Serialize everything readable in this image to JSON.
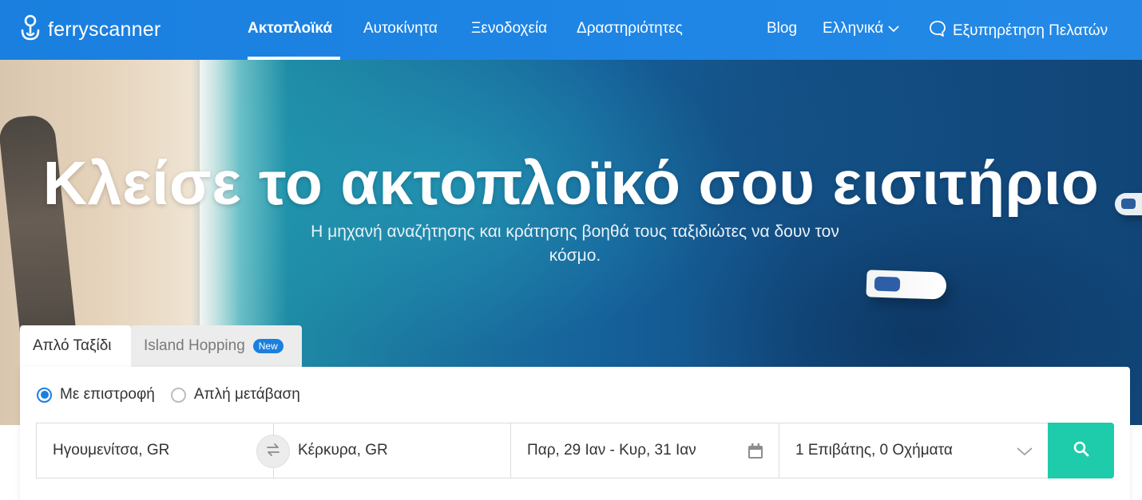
{
  "header": {
    "logo_text": "ferryscanner",
    "nav": [
      {
        "label": "Ακτοπλοϊκά",
        "active": true
      },
      {
        "label": "Αυτοκίνητα",
        "active": false
      },
      {
        "label": "Ξενοδοχεία",
        "active": false
      },
      {
        "label": "Δραστηριότητες",
        "active": false
      }
    ],
    "blog_label": "Blog",
    "language_label": "Ελληνικά",
    "support_label": "Εξυπηρέτηση Πελατών"
  },
  "hero": {
    "title": "Κλείσε το ακτοπλοϊκό σου εισιτήριο",
    "subtitle": "Η μηχανή αναζήτησης και κράτησης βοηθά τους ταξιδιώτες να δουν τον κόσμο."
  },
  "tabs": [
    {
      "label": "Απλό Ταξίδι",
      "active": true
    },
    {
      "label": "Island Hopping",
      "active": false,
      "badge": "New"
    }
  ],
  "trip_type": {
    "options": [
      {
        "label": "Με επιστροφή",
        "checked": true
      },
      {
        "label": "Απλή μετάβαση",
        "checked": false
      }
    ]
  },
  "search": {
    "from": "Ηγουμενίτσα, GR",
    "to": "Κέρκυρα, GR",
    "dates": "Παρ, 29 Ιαν - Κυρ, 31 Ιαν",
    "passengers": "1 Επιβάτης, 0 Οχήματα"
  },
  "colors": {
    "header_blue": "#1f86e6",
    "accent_blue": "#1b7fe0",
    "search_button": "#1ecbaa"
  },
  "icons": {
    "logo": "person-anchor-icon",
    "language_chevron": "chevron-down-icon",
    "support": "chat-bubble-icon",
    "swap": "swap-arrows-icon",
    "date": "calendar-icon",
    "passengers_chevron": "chevron-down-icon",
    "search": "search-icon"
  }
}
